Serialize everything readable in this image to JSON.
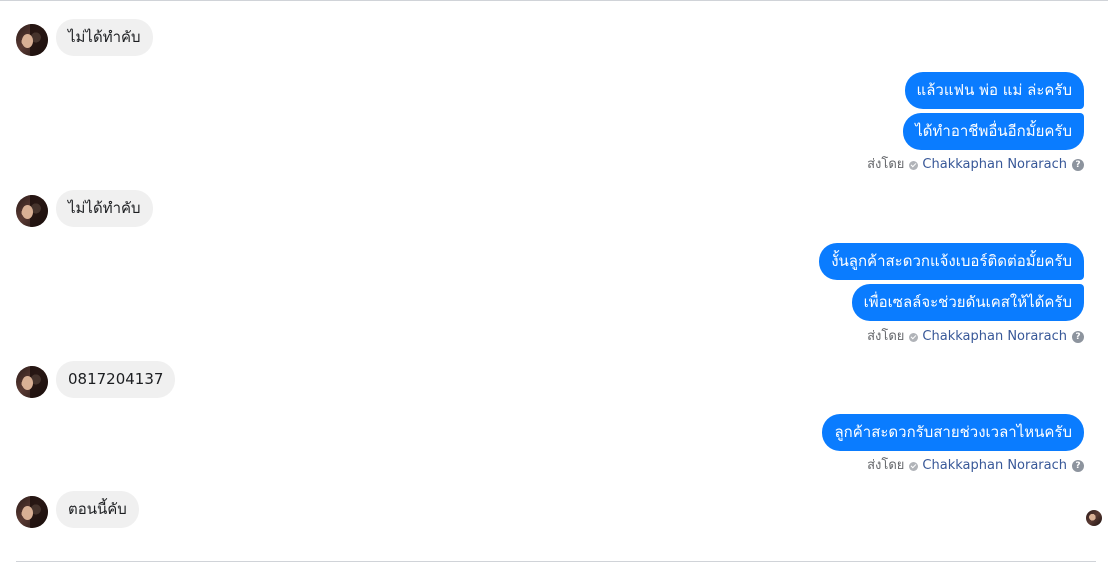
{
  "conversation": {
    "incoming": [
      {
        "text": "ไม่ได้ทำคับ"
      },
      {
        "text": "ไม่ได้ทำคับ"
      },
      {
        "text": "0817204137"
      },
      {
        "text": "ตอนนี้คับ"
      }
    ],
    "outgoing": [
      {
        "text": "แล้วแฟน พ่อ แม่ ล่ะครับ"
      },
      {
        "text": "ได้ทำอาชีพอื่นอีกมั้ยครับ"
      },
      {
        "text": "งั้นลูกค้าสะดวกแจ้งเบอร์ติดต่อมั้ยครับ"
      },
      {
        "text": "เพื่อเซลล์จะช่วยดันเคสให้ได้ครับ"
      },
      {
        "text": "ลูกค้าสะดวกรับสายช่วงเวลาไหนครับ"
      }
    ],
    "sent_by": {
      "prefix": "ส่งโดย",
      "sender_name": "Chakkaphan Norarach",
      "help_glyph": "?"
    }
  },
  "colors": {
    "outgoing_bubble": "#0a7cff",
    "incoming_bubble": "#f0f0f0",
    "sender_name": "#385898"
  },
  "icons": {
    "verified": "verified-check-icon",
    "help": "help-icon"
  }
}
